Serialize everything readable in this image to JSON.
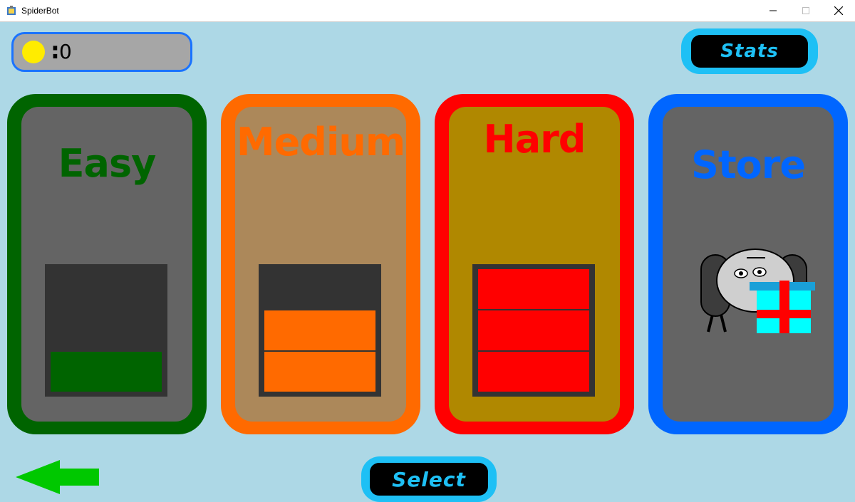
{
  "window": {
    "title": "SpiderBot"
  },
  "hud": {
    "coin_separator": ":",
    "coin_count": "0"
  },
  "buttons": {
    "stats_label": "Stats",
    "select_label": "Select"
  },
  "cards": [
    {
      "id": "easy",
      "label": "Easy",
      "border_color": "#006400",
      "inner_color": "#646464",
      "text_color": "#006400",
      "bars_filled": 1,
      "bar_color": "#006400"
    },
    {
      "id": "medium",
      "label": "Medium",
      "border_color": "#ff6a00",
      "inner_color": "#ac885a",
      "text_color": "#ff6a00",
      "bars_filled": 2,
      "bar_color": "#ff6a00"
    },
    {
      "id": "hard",
      "label": "Hard",
      "border_color": "#ff0000",
      "inner_color": "#b08800",
      "text_color": "#ff0000",
      "bars_filled": 3,
      "bar_color": "#ff0000"
    },
    {
      "id": "store",
      "label": "Store",
      "border_color": "#0066ff",
      "inner_color": "#646464",
      "text_color": "#0066ff"
    }
  ],
  "colors": {
    "background": "#add8e6",
    "accent_cyan": "#1ec0f5",
    "back_arrow": "#00c800",
    "coin": "#ffec00"
  },
  "icons": {
    "back": "left-arrow-icon",
    "store": "robot-gift-icon",
    "coin": "coin-icon"
  }
}
